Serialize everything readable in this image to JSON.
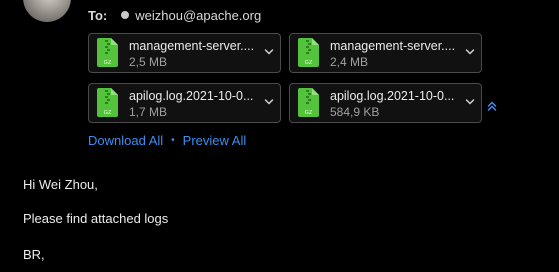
{
  "header": {
    "to_label": "To:",
    "recipient": "weizhou@apache.org"
  },
  "attachments": [
    {
      "name": "management-server....",
      "size": "2,5 MB",
      "icon": "gz-archive-icon"
    },
    {
      "name": "management-server....",
      "size": "2,4 MB",
      "icon": "gz-archive-icon"
    },
    {
      "name": "apilog.log.2021-10-0...",
      "size": "1,7 MB",
      "icon": "gz-archive-icon"
    },
    {
      "name": "apilog.log.2021-10-0...",
      "size": "584,9 KB",
      "icon": "gz-archive-icon"
    }
  ],
  "attachment_icon_text": "GZ",
  "actions": {
    "download_all": "Download All",
    "separator": "•",
    "preview_all": "Preview All"
  },
  "body": {
    "greeting": "Hi Wei Zhou,",
    "line1": "Please find attached logs",
    "signoff": "BR,"
  },
  "colors": {
    "background": "#000000",
    "link": "#3d8ef0",
    "gz_icon_green": "#52c33a"
  }
}
